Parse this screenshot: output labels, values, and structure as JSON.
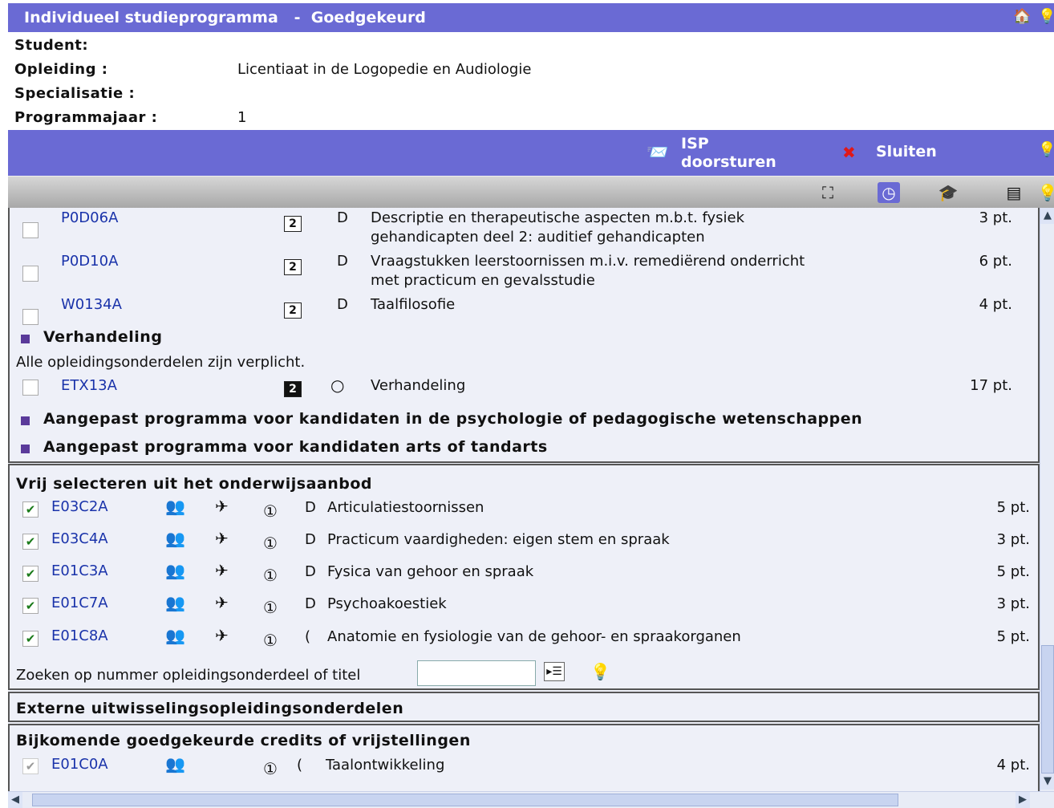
{
  "window": {
    "title": "Individueel studieprogramma",
    "status": "Goedgekeurd",
    "separator": "-"
  },
  "icons": {
    "home": "home-icon",
    "help": "help-bulb-icon"
  },
  "student": {
    "student_label": "Student:",
    "student_value": "",
    "opleiding_label": "Opleiding :",
    "opleiding_value": "Licentiaat in de Logopedie en Audiologie",
    "specialisatie_label": "Specialisatie :",
    "specialisatie_value": "",
    "programmajaar_label": "Programmajaar :",
    "programmajaar_value": "1"
  },
  "actions": {
    "send_label_1": "ISP",
    "send_label_2": "doorsturen",
    "close_label": "Sluiten"
  },
  "toolbar": [
    "tree-icon",
    "clock-icon",
    "graduation-icon",
    "list-icon",
    "help-bulb-icon"
  ],
  "colors": {
    "header": "#6a6ad4",
    "link": "#1a33aa",
    "bullet": "#5a3a9a"
  },
  "courses_top": [
    {
      "code": "P0D06A",
      "year": "2",
      "type": "D",
      "desc1": "Descriptie en therapeutische aspecten m.b.t. fysiek",
      "desc2": "gehandicapten deel 2: auditief gehandicapten",
      "pts": "3 pt."
    },
    {
      "code": "P0D10A",
      "year": "2",
      "type": "D",
      "desc1": "Vraagstukken leerstoornissen m.i.v. remediërend onderricht",
      "desc2": "met practicum en gevalsstudie",
      "pts": "6 pt."
    },
    {
      "code": "W0134A",
      "year": "2",
      "type": "D",
      "desc1": "Taalfilosofie",
      "desc2": "",
      "pts": "4 pt."
    }
  ],
  "verhandeling": {
    "title": "Verhandeling",
    "note": "Alle opleidingsonderdelen zijn verplicht.",
    "code": "ETX13A",
    "year": "2",
    "type": "O",
    "desc": "Verhandeling",
    "pts": "17 pt."
  },
  "sections_extra": [
    "Aangepast programma voor kandidaten in de psychologie of pedagogische wetenschappen",
    "Aangepast programma voor kandidaten arts of tandarts"
  ],
  "vrij": {
    "title": "Vrij selecteren uit het onderwijsaanbod",
    "items": [
      {
        "code": "E03C2A",
        "num": "1",
        "type": "D",
        "desc": "Articulatiestoornissen",
        "pts": "5 pt."
      },
      {
        "code": "E03C4A",
        "num": "1",
        "type": "D",
        "desc": "Practicum vaardigheden: eigen stem en spraak",
        "pts": "3 pt."
      },
      {
        "code": "E01C3A",
        "num": "1",
        "type": "D",
        "desc": "Fysica van gehoor en spraak",
        "pts": "5 pt."
      },
      {
        "code": "E01C7A",
        "num": "1",
        "type": "D",
        "desc": "Psychoakoestiek",
        "pts": "3 pt."
      },
      {
        "code": "E01C8A",
        "num": "1",
        "type": "(",
        "desc": "Anatomie en fysiologie van de gehoor- en spraakorganen",
        "pts": "5 pt."
      }
    ],
    "search_label": "Zoeken op nummer opleidingsonderdeel of titel",
    "search_value": ""
  },
  "extern": {
    "title": "Externe uitwisselingsopleidingsonderdelen"
  },
  "bijkomend": {
    "title": "Bijkomende goedgekeurde credits of vrijstellingen",
    "code": "E01C0A",
    "num": "1",
    "type": "(",
    "desc": "Taalontwikkeling",
    "pts": "4 pt."
  }
}
